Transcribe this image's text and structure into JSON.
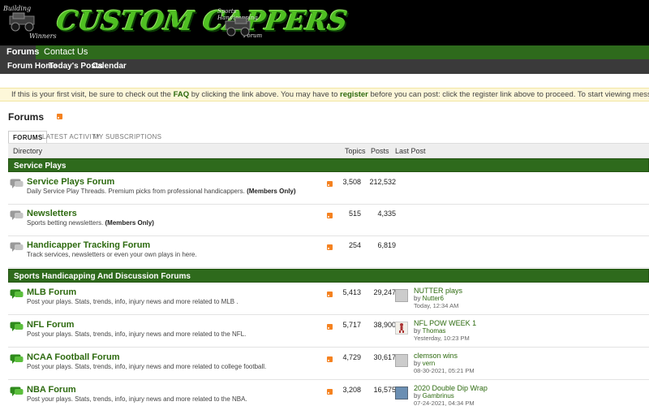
{
  "header": {
    "logo_title": "CUSTOM CAPPERS",
    "left_tag_line1": "Building",
    "left_tag_line2": "Winners",
    "right_tag_line1": "Sports Handicapping",
    "right_tag_line2": "Forum"
  },
  "nav": {
    "tabs": [
      {
        "label": "Forums"
      },
      {
        "label": "Contact Us"
      }
    ],
    "subnav": [
      {
        "label": "Forum Home"
      },
      {
        "label": "Today's Posts"
      },
      {
        "label": "Calendar"
      }
    ]
  },
  "notice": {
    "part1": "If this is your first visit, be sure to check out the ",
    "faq": "FAQ",
    "part2": " by clicking the link above. You may have to ",
    "register": "register",
    "part3": " before you can post: click the register link above to proceed. To start viewing messages, select the forum that you want to visit from the selection bel"
  },
  "page_title": "Forums",
  "tabs": [
    {
      "label": "FORUMS"
    },
    {
      "label": "LATEST ACTIVITY"
    },
    {
      "label": "MY SUBSCRIPTIONS"
    }
  ],
  "table_header": {
    "directory": "Directory",
    "topics": "Topics",
    "posts": "Posts",
    "last_post": "Last Post"
  },
  "categories": [
    {
      "title": "Service Plays",
      "forums": [
        {
          "name": "Service Plays Forum",
          "desc": "Daily Service Play Threads. Premium picks from professional handicappers. ",
          "desc_bold": "(Members Only)",
          "topics": "3,508",
          "posts": "212,532"
        },
        {
          "name": "Newsletters",
          "desc": "Sports betting newsletters. ",
          "desc_bold": "(Members Only)",
          "topics": "515",
          "posts": "4,335"
        },
        {
          "name": "Handicapper Tracking Forum",
          "desc": "Track services, newsletters or even your own plays in here.",
          "desc_bold": "",
          "topics": "254",
          "posts": "6,819"
        }
      ]
    },
    {
      "title": "Sports Handicapping And Discussion Forums",
      "forums": [
        {
          "name": "MLB Forum",
          "desc": "Post your plays. Stats, trends, info, injury news and more related to MLB .",
          "topics": "5,413",
          "posts": "29,247",
          "last_title": "NUTTER plays",
          "last_by": "by ",
          "last_user": "Nutter6",
          "last_date": "Today, 12:34 AM"
        },
        {
          "name": "NFL Forum",
          "desc": "Post your plays. Stats, trends, info, injury news and more related to the NFL.",
          "topics": "5,717",
          "posts": "38,900",
          "last_title": "NFL POW WEEK 1",
          "last_by": "by ",
          "last_user": "Thomas",
          "last_date": "Yesterday, 10:23 PM"
        },
        {
          "name": "NCAA Football Forum",
          "desc": "Post your plays. Stats, trends, info, injury news and more related to college football.",
          "topics": "4,729",
          "posts": "30,617",
          "last_title": "clemson wins",
          "last_by": "by ",
          "last_user": "vern",
          "last_date": "08-30-2021, 05:21 PM"
        },
        {
          "name": "NBA Forum",
          "desc": "Post your plays. Stats, trends, info, injury news and more related to the NBA.",
          "topics": "3,208",
          "posts": "16,575",
          "last_title": "2020 Double Dip Wrap",
          "last_by": "by ",
          "last_user": "Gambrinus",
          "last_date": "07-24-2021, 04:34 PM"
        }
      ]
    }
  ],
  "colors": {
    "brand_green": "#2e6a1c",
    "link_green": "#2d6a0f",
    "rss_orange": "#f58220",
    "notice_bg": "#fdf7d9"
  }
}
